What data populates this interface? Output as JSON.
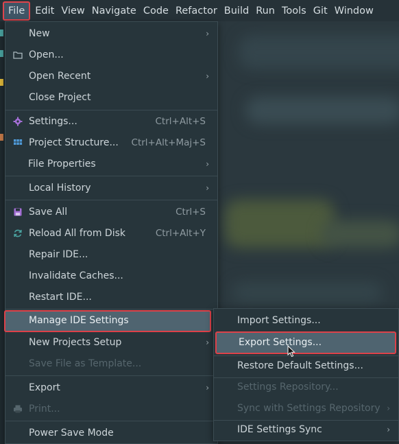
{
  "menubar": {
    "items": [
      "File",
      "Edit",
      "View",
      "Navigate",
      "Code",
      "Refactor",
      "Build",
      "Run",
      "Tools",
      "Git",
      "Window"
    ]
  },
  "file_menu": {
    "new": "New",
    "open": "Open...",
    "open_recent": "Open Recent",
    "close_project": "Close Project",
    "settings": "Settings...",
    "settings_shortcut": "Ctrl+Alt+S",
    "project_structure": "Project Structure...",
    "project_structure_shortcut": "Ctrl+Alt+Maj+S",
    "file_properties": "File Properties",
    "local_history": "Local History",
    "save_all": "Save All",
    "save_all_shortcut": "Ctrl+S",
    "reload_all": "Reload All from Disk",
    "reload_all_shortcut": "Ctrl+Alt+Y",
    "repair_ide": "Repair IDE...",
    "invalidate_caches": "Invalidate Caches...",
    "restart_ide": "Restart IDE...",
    "manage_ide_settings": "Manage IDE Settings",
    "new_projects_setup": "New Projects Setup",
    "save_file_as_template": "Save File as Template...",
    "export": "Export",
    "print": "Print...",
    "power_save_mode": "Power Save Mode"
  },
  "submenu": {
    "import_settings": "Import Settings...",
    "export_settings": "Export Settings...",
    "restore_default_settings": "Restore Default Settings...",
    "settings_repository": "Settings Repository...",
    "sync_with_settings_repository": "Sync with Settings Repository",
    "ide_settings_sync": "IDE Settings Sync"
  },
  "colors": {
    "highlight_border": "#dd4149",
    "highlight_bg": "#4f6470",
    "menu_bg": "#27353b"
  }
}
